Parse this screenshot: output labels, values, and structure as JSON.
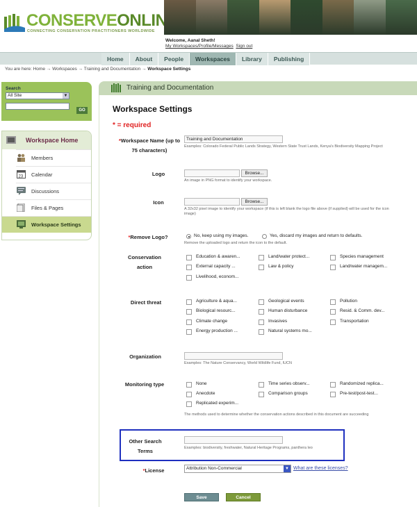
{
  "header": {
    "logo_conserve": "CONSERVE",
    "logo_online": "ONLINE",
    "tagline": "CONNECTING CONSERVATION PRACTITIONERS WORLDWIDE",
    "welcome": "Welcome, Aanal Sheth!",
    "link_account": "My Workspaces/Profile/Messages",
    "link_signout": "Sign out",
    "photo_colors": [
      "#6b5a44",
      "#8a7a66",
      "#3f5a3a",
      "#b89a70",
      "#2f4a2f",
      "#7a6a4a",
      "#8f9a86",
      "#4a6a4a"
    ]
  },
  "nav": {
    "tabs": [
      {
        "label": "Home"
      },
      {
        "label": "About"
      },
      {
        "label": "People"
      },
      {
        "label": "Workspaces"
      },
      {
        "label": "Library"
      },
      {
        "label": "Publishing"
      }
    ],
    "active": "Workspaces"
  },
  "breadcrumb": {
    "prefix": "You are here:",
    "home": "Home",
    "workspaces": "Workspaces",
    "training": "Training and Documentation",
    "current": "Workspace Settings",
    "sep": "→"
  },
  "sidebar": {
    "search_label": "Search",
    "scope": "All Site",
    "go": "GO",
    "home_label": "Workspace Home",
    "items": [
      {
        "label": "Members",
        "icon": "members-icon"
      },
      {
        "label": "Calendar",
        "icon": "calendar-icon"
      },
      {
        "label": "Discussions",
        "icon": "discussions-icon"
      },
      {
        "label": "Files & Pages",
        "icon": "files-icon"
      },
      {
        "label": "Workspace Settings",
        "icon": "settings-icon"
      }
    ]
  },
  "main": {
    "section_title": "Training and Documentation",
    "page_title": "Workspace Settings",
    "required_note": "* = required",
    "name_label": "Workspace Name (up to 75 characters)",
    "name_value": "Training and Documentation",
    "name_hint": "Examples: Colorado Federal Public Lands Strategy, Western State Trust Lands, Kenya's Biodiversity Mapping Project",
    "logo_label": "Logo",
    "logo_hint": "An image in PNG format to identify your workspace.",
    "icon_label": "Icon",
    "icon_hint": "A 32x32 pixel image to identify your workspace (if this is left blank the logo file above (if supplied) will be used for the icon image)",
    "browse": "Browse...",
    "remove_logo_label": "Remove Logo?",
    "remove_no": "No, keep using my images.",
    "remove_yes": "Yes, discard my images and return to defaults.",
    "remove_hint": "Remove the uploaded logo and return the icon to the default.",
    "conservation_label": "Conservation action",
    "conservation_options": [
      "Education & awaren...",
      "Land/water protect...",
      "Species management",
      "External capacity ...",
      "Law & policy",
      "Land/water managem...",
      "Livelihood, econom..."
    ],
    "threat_label": "Direct threat",
    "threat_options": [
      "Agriculture & aqua...",
      "Geological events",
      "Pollution",
      "Biological resourc...",
      "Human disturbance",
      "Resid. & Comm. dev...",
      "Climate change",
      "Invasives",
      "Transportation",
      "Energy production ...",
      "Natural systems mo..."
    ],
    "org_label": "Organization",
    "org_hint": "Examples: The Nature Conservancy, World Wildlife Fund, IUCN",
    "monitoring_label": "Monitoring type",
    "monitoring_options": [
      "None",
      "Time series observ...",
      "Randomized replica...",
      "Anecdote",
      "Comparison groups",
      "Pre-test/post-test...",
      "Replicated experim..."
    ],
    "monitoring_hint": "The methods used to determine whether the conservation actions described in this document are succeeding",
    "other_label": "Other Search Terms",
    "other_hint": "Examples: biodiversity, freshwater, Natural Heritage Programs, panthera leo",
    "license_label": "License",
    "license_value": "Attribution Non-Commercial",
    "license_link": "What are these licenses?",
    "save": "Save",
    "cancel": "Cancel"
  }
}
